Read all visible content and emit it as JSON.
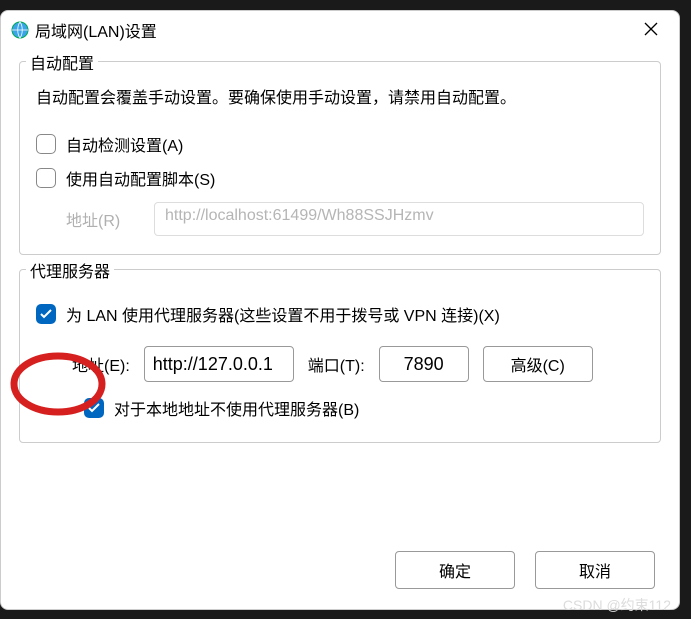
{
  "title": "局域网(LAN)设置",
  "auto_config": {
    "group_label": "自动配置",
    "desc": "自动配置会覆盖手动设置。要确保使用手动设置，请禁用自动配置。",
    "auto_detect": {
      "label": "自动检测设置(A)",
      "checked": false
    },
    "use_script": {
      "label": "使用自动配置脚本(S)",
      "checked": false
    },
    "address_label": "地址(R)",
    "address_value": "http://localhost:61499/Wh88SSJHzmv"
  },
  "proxy": {
    "group_label": "代理服务器",
    "use_proxy": {
      "label": "为 LAN 使用代理服务器(这些设置不用于拨号或 VPN 连接)(X)",
      "checked": true
    },
    "address_label": "地址(E):",
    "address_value": "http://127.0.0.1",
    "port_label": "端口(T):",
    "port_value": "7890",
    "advanced_label": "高级(C)",
    "bypass_local": {
      "label": "对于本地地址不使用代理服务器(B)",
      "checked": true
    }
  },
  "buttons": {
    "ok": "确定",
    "cancel": "取消"
  },
  "watermark": "CSDN @约束112"
}
